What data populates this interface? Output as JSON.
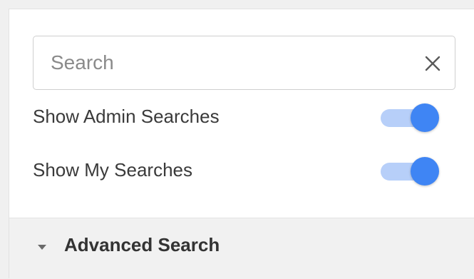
{
  "search": {
    "placeholder": "Search",
    "value": "",
    "clear_icon": "close-icon"
  },
  "toggles": [
    {
      "label": "Show Admin Searches",
      "checked": true
    },
    {
      "label": "Show My Searches",
      "checked": true
    }
  ],
  "advanced": {
    "label": "Advanced Search",
    "icon": "caret-down-icon",
    "expanded": false
  },
  "colors": {
    "toggle_on_thumb": "#3f85f4",
    "toggle_on_track": "#b7cff9",
    "section_background": "#f1f1f1"
  }
}
